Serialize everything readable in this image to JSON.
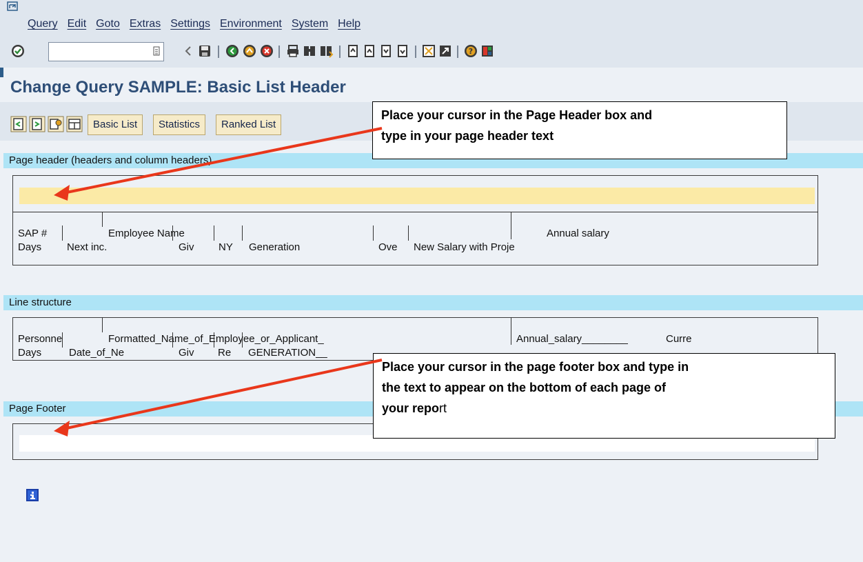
{
  "menu": {
    "items": [
      "Query",
      "Edit",
      "Goto",
      "Extras",
      "Settings",
      "Environment",
      "System",
      "Help"
    ]
  },
  "toolbar": {
    "command_field_value": ""
  },
  "title": "Change Query SAMPLE: Basic List Header",
  "app_toolbar": {
    "buttons": [
      "Basic List",
      "Statistics",
      "Ranked List"
    ]
  },
  "sections": {
    "page_header": {
      "label": "Page header (headers and column headers)",
      "input_value": "",
      "row1": [
        "SAP #",
        "Employee Name",
        "Annual salary"
      ],
      "row2": [
        "Days",
        "Next inc.",
        "Giv",
        "NY",
        "Generation",
        "Ove",
        "New Salary with Proje"
      ]
    },
    "line_structure": {
      "label": "Line structure",
      "row1": [
        "Personne",
        "Formatted_Name_of_Employee_or_Applicant_",
        "Annual_salary________",
        "Curre"
      ],
      "row2": [
        "Days",
        "Date_of_Ne",
        "Giv",
        "Re",
        "GENERATION__"
      ]
    },
    "page_footer": {
      "label": "Page Footer",
      "input_value": ""
    }
  },
  "callouts": {
    "header": {
      "line1": "Place your cursor in the Page Header box and",
      "line2": "type in your page header text"
    },
    "footer": {
      "line1": "Place your cursor in the page footer box and type in",
      "line2": "the text to appear on the bottom of each page of",
      "line3_bold": "your repo",
      "line3_normal": "rt"
    }
  },
  "colors": {
    "section_bar": "#aee4f6",
    "header_input": "#fbeaa6",
    "title": "#2e4e77",
    "arrow": "#e9371b",
    "button_bg": "#f6ebc9"
  }
}
